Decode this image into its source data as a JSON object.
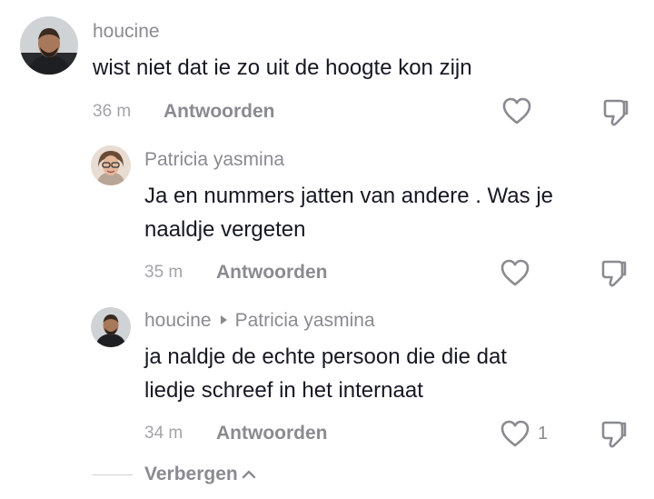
{
  "comments": [
    {
      "username": "houcine",
      "text_lines": [
        "wist niet dat ie zo uit de hoogte kon zijn"
      ],
      "time": "36 m",
      "reply_label": "Antwoorden"
    },
    {
      "username": "Patricia yasmina",
      "text_lines": [
        "Ja en nummers jatten van andere . Was je",
        "naaldje vergeten"
      ],
      "time": "35 m",
      "reply_label": "Antwoorden"
    },
    {
      "username": "houcine",
      "reply_to": "Patricia yasmina",
      "text_lines": [
        "ja naldje de echte persoon die die dat",
        "liedje schreef in het internaat"
      ],
      "time": "34 m",
      "reply_label": "Antwoorden",
      "like_count": "1"
    }
  ],
  "hide_replies_label": "Verbergen",
  "colors": {
    "text": "#161823",
    "muted": "#8a8b91",
    "time": "#a3a4a8"
  },
  "icons": [
    "heart-icon",
    "dislike-icon",
    "chevron-up-icon"
  ]
}
